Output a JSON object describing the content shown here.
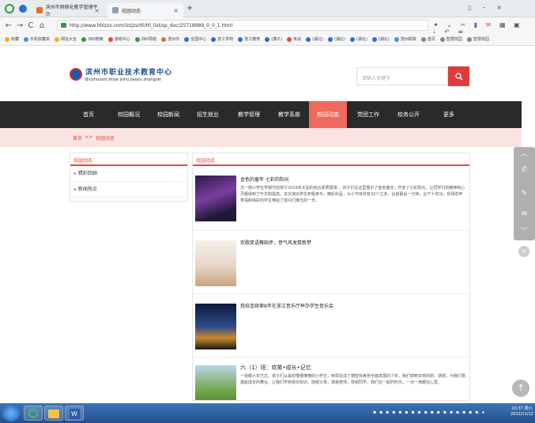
{
  "browser": {
    "tabs": [
      {
        "label": "滨州市网络化教学管理平台"
      },
      {
        "label": "校园动态"
      }
    ],
    "url": "http://www.hblzzx.com/lzzjzs/ttl/ttl_list/sp_doc/25718989_0_0_1.html",
    "bookmarks": [
      "收藏",
      "手机收藏夹",
      "网址大全",
      "360搜索",
      "游戏中心",
      "360导航",
      "滨州市",
      "全国中心",
      "技工学校",
      "技工教育",
      "(博子)",
      "免试",
      "(湖北)",
      "(湖北)",
      "(湖北)",
      "(湖北)",
      "滨州职院",
      "首页",
      "智慧校园",
      "智慧校园"
    ]
  },
  "site": {
    "logo_cn": "滨州市职业技术教育中心",
    "logo_py": "Binzhoushi zhiye jishu jiaoyu zhongxin",
    "search_placeholder": "请输入关键字",
    "nav": [
      "首页",
      "校园概况",
      "校园新闻",
      "招生就业",
      "教学管理",
      "教学系部",
      "校园动态",
      "党团工作",
      "校务公开",
      "更多"
    ],
    "nav_active_index": 6,
    "breadcrumb": {
      "home": "首页",
      "sep": ">>",
      "current": "校园动态"
    },
    "sidebar": {
      "heading": "校园动态",
      "items": [
        "精彩回顾",
        "新闻热点"
      ]
    },
    "main": {
      "heading": "校园动态",
      "articles": [
        {
          "title": "金色的童年 七彩的阳光",
          "text": "文一部小学在学期节前举行2019年大型的综合素质展演 ，孩子们在这里展示了金色童年，开放了七彩阳光，让同学们的精神和心灵都得到了升华和提高。本次演出学生积极参与，精彩纷呈，大小节目共有32个之多，台前幕后一分钟，台下十年功，现场欢声笑语和喝彩的学生带给了观众们难忘的一天。"
        },
        {
          "title": "欢歌笑语舞蹈步，意气风发筑新梦",
          "text": ""
        },
        {
          "title": "我校连续第8年在浙江音乐厅举办学生音乐会",
          "text": ""
        },
        {
          "title": "六（1）班：欢笑•成长•记忆",
          "text": "一晃眼六年已过，孩子们从最初懵懵懂懂的小学生，到现在成了德智体美劳全面发展的少年，我们感到非常欣慰。感谢，为我们搭建起成长的舞台，让我们学到很多知识，感谢父母，感谢老师，感谢同学，我们在一起的时光，一点一滴都在心里。"
        }
      ]
    }
  },
  "taskbar": {
    "time": "20:37 周六",
    "date": "2022/11/12"
  }
}
